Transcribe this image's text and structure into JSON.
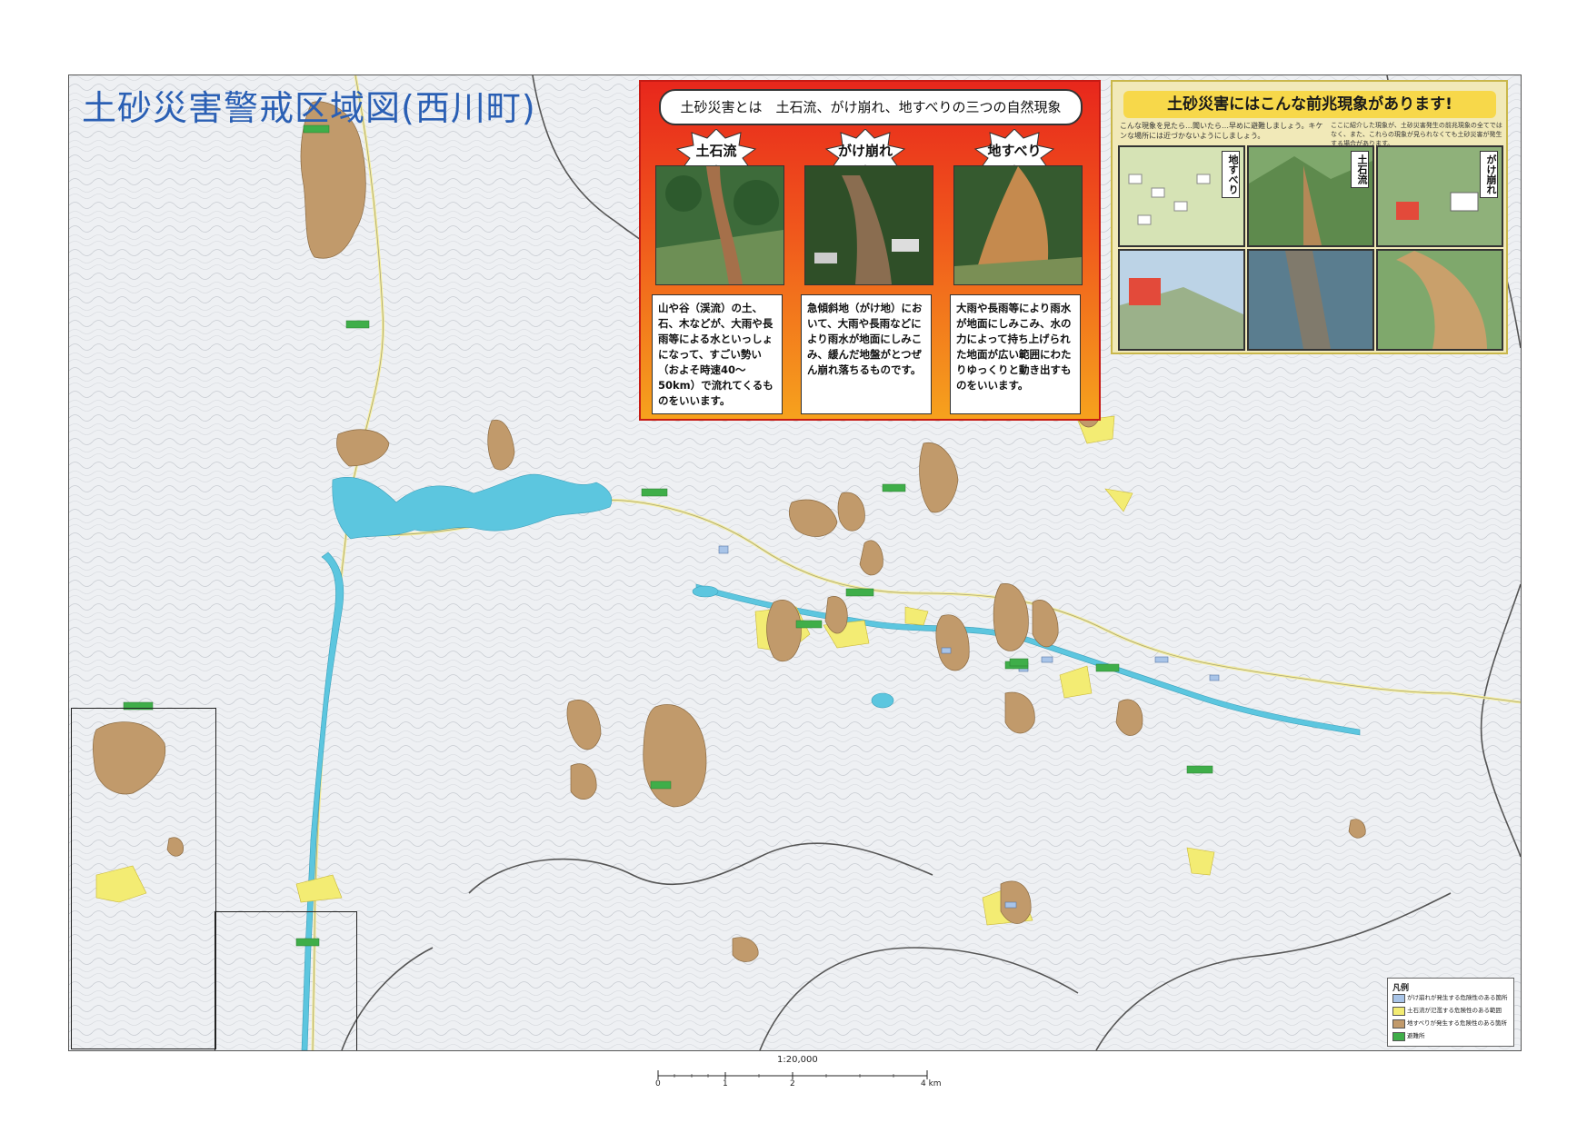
{
  "map": {
    "title": "土砂災害警戒区域図(西川町)",
    "scale": "1:20,000",
    "scale_ticks": [
      "0",
      "1",
      "2",
      "4 km"
    ]
  },
  "info_panel": {
    "heading": "土砂災害とは　土石流、がけ崩れ、地すべりの三つの自然現象",
    "hazards": [
      {
        "label": "土石流",
        "description": "山や谷（渓流）の土、石、木などが、大雨や長雨等による水といっしょになって、すごい勢い（およそ時速40〜50km）で流れてくるものをいいます。"
      },
      {
        "label": "がけ崩れ",
        "description": "急傾斜地（がけ地）において、大雨や長雨などにより雨水が地面にしみこみ、緩んだ地盤がとつぜん崩れ落ちるものです。"
      },
      {
        "label": "地すべり",
        "description": "大雨や長雨等により雨水が地面にしみこみ、水の力によって持ち上げられた地面が広い範囲にわたりゆっくりと動き出すものをいいます。"
      }
    ]
  },
  "warning_panel": {
    "title": "土砂災害にはこんな前兆現象があります!",
    "intro": "こんな現象を見たら…聞いたら…早めに避難しましょう。キケンな場所には近づかないようにしましょう。",
    "intro_right": "ここに紹介した現象が、土砂災害発生の前兆現象の全てではなく、また、これらの現象が見られなくても土砂災害が発生する場合があります。",
    "tags": [
      "地すべり",
      "土石流",
      "がけ崩れ"
    ]
  },
  "legend": {
    "title": "凡例",
    "items": [
      {
        "label": "がけ崩れが発生する危険性のある箇所",
        "color": "#a8c4e8"
      },
      {
        "label": "土石流が氾濫する危険性のある範囲",
        "color": "#f3ec73"
      },
      {
        "label": "地すべりが発生する危険性のある箇所",
        "color": "#c19a6b"
      },
      {
        "label": "避難所",
        "color": "#3fae49"
      }
    ]
  },
  "colors": {
    "landslide": "#c19a6b",
    "debris_flow": "#f3ec73",
    "slope_failure": "#a8c4e8",
    "water": "#5cc6df",
    "shelter": "#3fae49",
    "title": "#2a5fb4"
  }
}
